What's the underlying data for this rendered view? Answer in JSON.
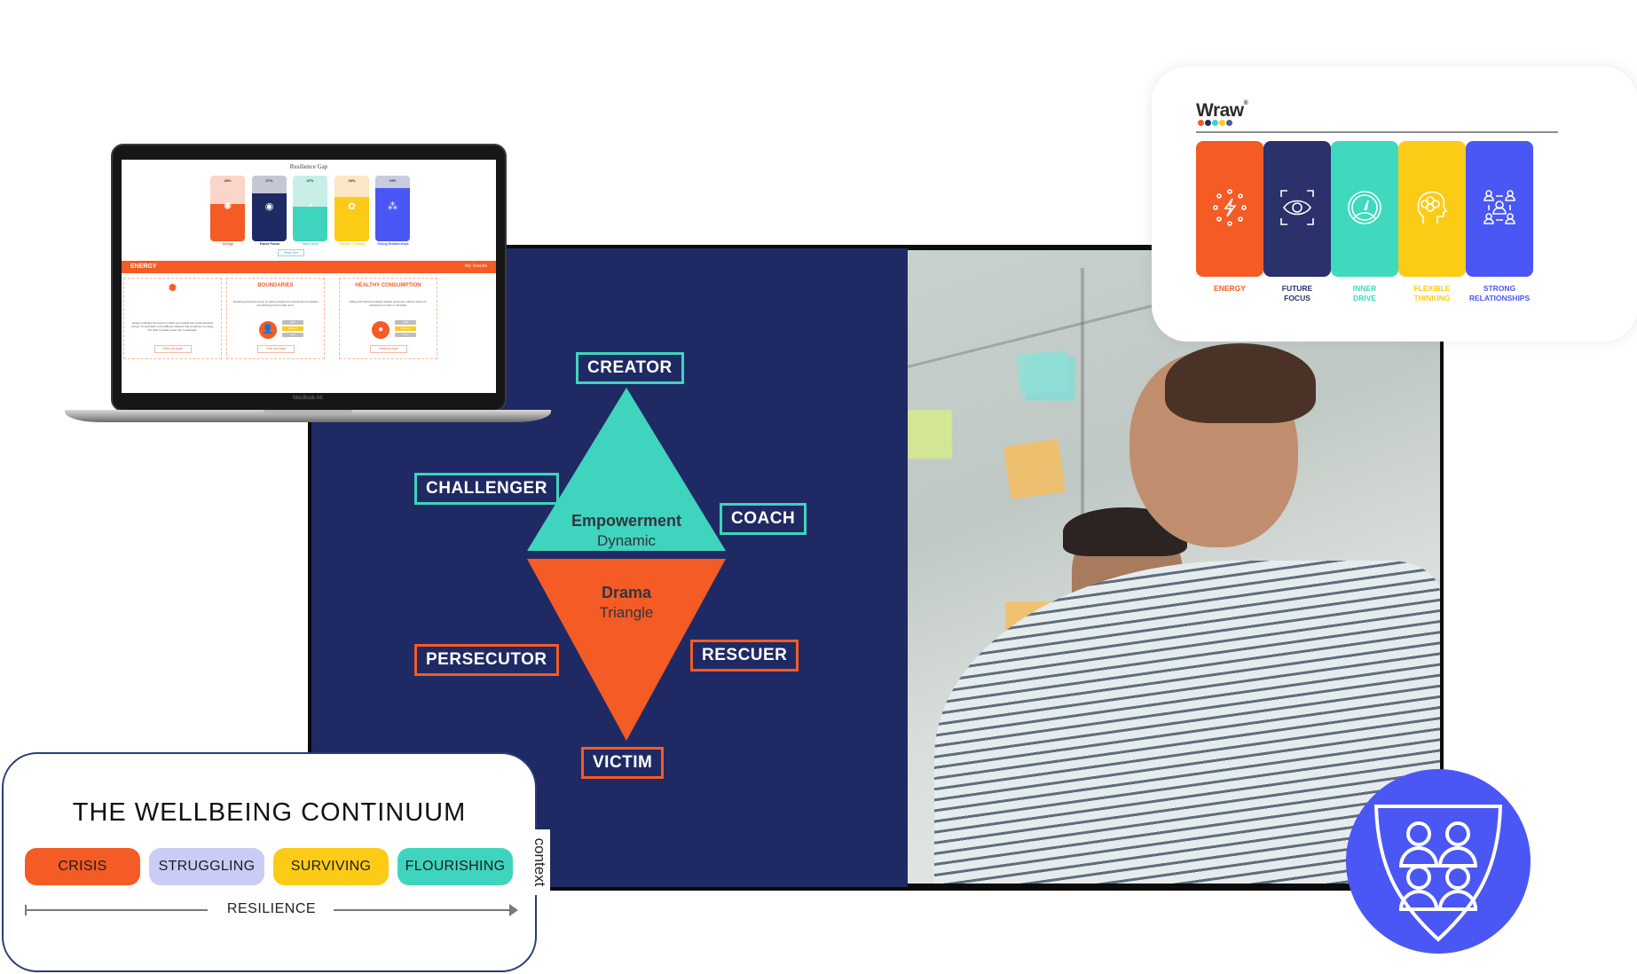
{
  "laptop": {
    "device_label": "MacBook Air",
    "gap_title": "Resilience Gap",
    "bars": [
      {
        "name": "Energy",
        "percent_label": "43%",
        "fill_fraction": 0.57,
        "color": "#f45b25",
        "light": "#f9d6c8",
        "label_color": "#f45b25"
      },
      {
        "name": "Future Focus",
        "percent_label": "27%",
        "fill_fraction": 0.73,
        "color": "#1f2a64",
        "light": "#c5c8d4",
        "label_color": "#1f2a64"
      },
      {
        "name": "Inner Drive",
        "percent_label": "47%",
        "fill_fraction": 0.53,
        "color": "#3fd4bd",
        "light": "#c8efe7",
        "label_color": "#3fd4bd"
      },
      {
        "name": "Flexible Thinking",
        "percent_label": "33%",
        "fill_fraction": 0.67,
        "color": "#fccb16",
        "light": "#fbe7c6",
        "label_color": "#fccb16"
      },
      {
        "name": "Strong Relationships",
        "percent_label": "19%",
        "fill_fraction": 0.81,
        "color": "#4a57f4",
        "light": "#c9cbe0",
        "label_color": "#4a57f4"
      }
    ],
    "read_text_label": "Read Text",
    "section_title": "ENERGY",
    "my_results_label": "My Results",
    "cards": [
      {
        "title": "",
        "body": "Energy indicates the extent to which you sustain and renew physical energy. To shed light on the different aspects that contribute to energy, this pillar is broken down into 4 subscales.",
        "button": "Find out more"
      },
      {
        "title": "BOUNDARIES",
        "body": "Sustaining physical energy by taking breaks and maintaining boundaries (not allowing work to take over).",
        "button": "Find out more",
        "levels": [
          "High",
          "Medium",
          "Low"
        ],
        "selected_level": "Medium"
      },
      {
        "title": "HEALTHY CONSUMPTION",
        "body": "Eating and drinking healthily despite pressures, without relying on substances to calm or stimulate.",
        "button": "Find out more",
        "levels": [
          "High",
          "Medium",
          "Low"
        ],
        "selected_level": "Medium"
      }
    ]
  },
  "diagram": {
    "roles": {
      "creator": "CREATOR",
      "challenger": "CHALLENGER",
      "coach": "COACH",
      "persecutor": "PERSECUTOR",
      "rescuer": "RESCUER",
      "victim": "VICTIM"
    },
    "top_triangle": {
      "title": "Empowerment",
      "subtitle": "Dynamic"
    },
    "bottom_triangle": {
      "title": "Drama",
      "subtitle": "Triangle"
    },
    "colors": {
      "background": "#1f2a64",
      "teal": "#3fd4bd",
      "orange": "#f45b25"
    }
  },
  "wraw_card": {
    "logo": "Wraw",
    "logo_mark": "®",
    "logo_dots": [
      "#f45b25",
      "#1f2a64",
      "#3fd4bd",
      "#fccb16",
      "#4c5a9b"
    ],
    "pillars": [
      {
        "label_line1": "ENERGY",
        "label_line2": "",
        "color": "#f45b25",
        "icon": "energy-bolt-icon"
      },
      {
        "label_line1": "FUTURE",
        "label_line2": "FOCUS",
        "color": "#2a316b",
        "icon": "eye-focus-icon"
      },
      {
        "label_line1": "INNER",
        "label_line2": "DRIVE",
        "color": "#3fd9be",
        "icon": "speedometer-icon"
      },
      {
        "label_line1": "FLEXIBLE",
        "label_line2": "THINKING",
        "color": "#fccb16",
        "icon": "head-brain-icon"
      },
      {
        "label_line1": "STRONG",
        "label_line2": "RELATIONSHIPS",
        "color": "#4a57f4",
        "icon": "people-network-icon"
      }
    ]
  },
  "continuum": {
    "title": "THE WELLBEING CONTINUUM",
    "stages": [
      {
        "label": "CRISIS",
        "color": "#f45b25"
      },
      {
        "label": "STRUGGLING",
        "color": "#c9ccf5"
      },
      {
        "label": "SURVIVING",
        "color": "#fccb16"
      },
      {
        "label": "FLOURISHING",
        "color": "#3fd4bd"
      }
    ],
    "axis_label": "RESILIENCE",
    "context_tab": "context"
  },
  "badge": {
    "icon": "shield-team-icon",
    "color": "#4a57f4"
  }
}
